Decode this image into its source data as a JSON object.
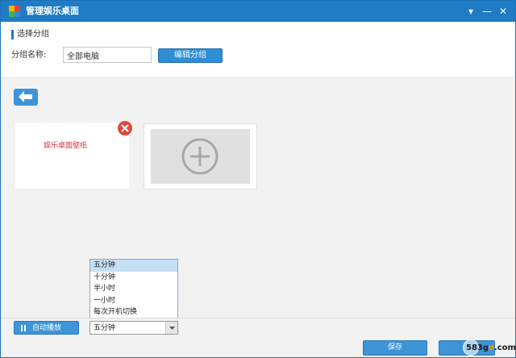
{
  "window": {
    "title": "管理娱乐桌面",
    "menu_glyph": "▾",
    "minimize_glyph": "—",
    "close_glyph": "✕"
  },
  "group": {
    "section_label": "选择分组",
    "name_label": "分组名称:",
    "name_value": "全部电脑",
    "edit_button": "编辑分组"
  },
  "cards": {
    "wallpaper_label": "娱乐桌面壁纸"
  },
  "interval": {
    "options": [
      "五分钟",
      "十分钟",
      "半小时",
      "一小时",
      "每次开机切换"
    ],
    "highlighted": "五分钟",
    "selected": "五分钟"
  },
  "footer": {
    "autoplay_label": "自动播放",
    "save_label": "保存"
  },
  "watermark": {
    "text_a": "583g",
    "text_o": "o",
    "text_b": ".com"
  },
  "colors": {
    "titlebar": "#1e7bc4",
    "button": "#3d94d6",
    "remove": "#e04a3a",
    "wallpaper_text": "#d0393e",
    "highlight": "#c5dff5"
  },
  "icons": {
    "app": "app-logo-icon",
    "back": "arrow-left-icon",
    "remove": "close-icon",
    "add": "plus-circle-icon",
    "autoplay": "pause-icon",
    "select": "chevron-down-icon"
  }
}
